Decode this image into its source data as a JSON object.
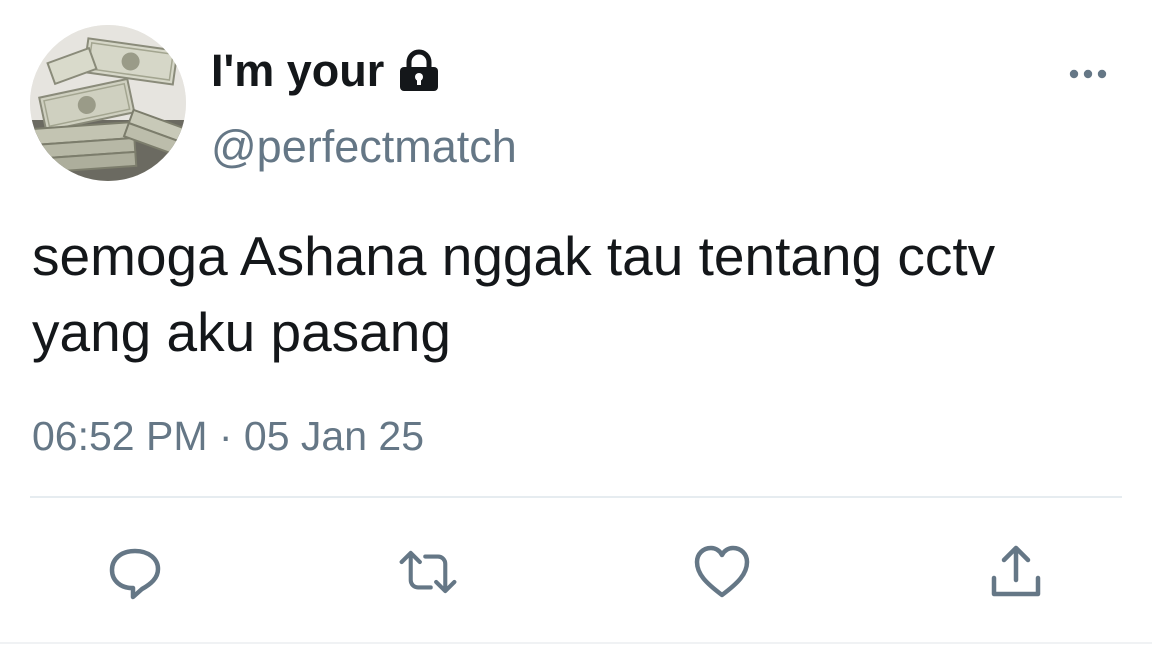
{
  "user": {
    "display_name": "I'm your",
    "name_emoji_icon": "lock-icon",
    "handle": "@perfectmatch",
    "avatar_icon": "money-stacks-avatar"
  },
  "tweet": {
    "text": "semoga Ashana nggak tau tentang cctv yang aku pasang",
    "timestamp": "06:52 PM · 05 Jan 25"
  },
  "actions": {
    "more_icon": "more-horizontal-icon",
    "reply_icon": "reply-icon",
    "retweet_icon": "retweet-icon",
    "like_icon": "heart-icon",
    "share_icon": "share-icon"
  },
  "colors": {
    "primary_text": "#14171a",
    "secondary_text": "#657786",
    "divider": "#e6ecf0",
    "icon": "#657786"
  }
}
